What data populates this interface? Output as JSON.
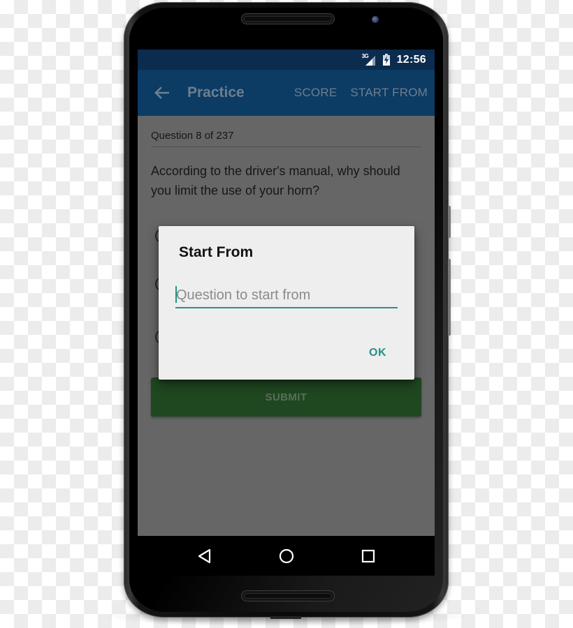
{
  "status_bar": {
    "network_label": "3G",
    "network_icon": "signal-icon",
    "battery_icon": "battery-charging-icon",
    "time": "12:56"
  },
  "app_bar": {
    "back_icon": "arrow-left-icon",
    "title": "Practice",
    "actions": [
      {
        "label": "SCORE"
      },
      {
        "label": "START FROM"
      }
    ]
  },
  "question": {
    "counter": "Question 8 of 237",
    "text": "According to the driver's manual, why should you limit the use of your horn?"
  },
  "submit": {
    "label": "SUBMIT"
  },
  "dialog": {
    "title": "Start From",
    "input_value": "",
    "input_placeholder": "Question to start from",
    "ok_label": "OK"
  },
  "nav_bar": {
    "back_icon": "nav-back-icon",
    "home_icon": "nav-home-icon",
    "recents_icon": "nav-recents-icon"
  },
  "colors": {
    "status_bar": "#0b2c4f",
    "app_bar": "#0c3b64",
    "accent": "#279084",
    "submit_button": "#1f4720",
    "scrim_content": "#666666",
    "dialog_background": "#eeeeee"
  }
}
